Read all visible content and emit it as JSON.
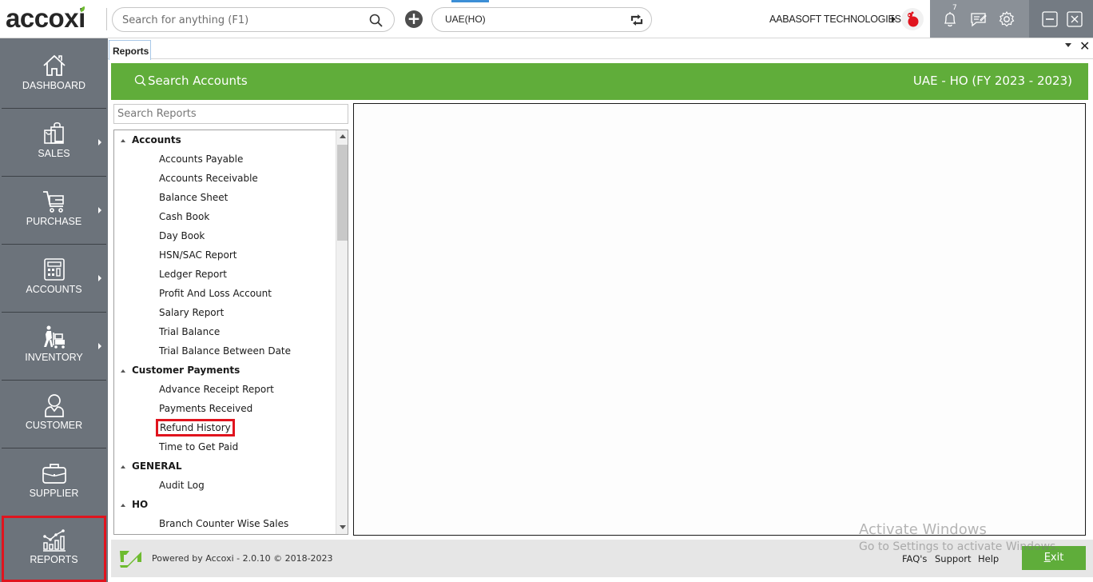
{
  "app": {
    "logo_text": "accoxi",
    "logo_dot_color": "#6dbb2f"
  },
  "topbar": {
    "search_placeholder": "Search for anything (F1)",
    "branch_value": "UAE(HO)",
    "company_name": "AABASOFT TECHNOLOGIES",
    "notification_count": "7",
    "icons": [
      "search-icon",
      "add-icon",
      "sync-icon",
      "bell-icon",
      "message-icon",
      "gear-icon",
      "minimize-icon",
      "close-icon"
    ]
  },
  "sidebar": {
    "items": [
      {
        "label": "DASHBOARD",
        "icon": "home-icon",
        "has_submenu": false
      },
      {
        "label": "SALES",
        "icon": "shopping-bag-icon",
        "has_submenu": true
      },
      {
        "label": "PURCHASE",
        "icon": "cart-icon",
        "has_submenu": true
      },
      {
        "label": "ACCOUNTS",
        "icon": "calculator-icon",
        "has_submenu": true
      },
      {
        "label": "INVENTORY",
        "icon": "trolley-worker-icon",
        "has_submenu": true
      },
      {
        "label": "CUSTOMER",
        "icon": "person-icon",
        "has_submenu": false
      },
      {
        "label": "SUPPLIER",
        "icon": "briefcase-icon",
        "has_submenu": false
      },
      {
        "label": "REPORTS",
        "icon": "chart-icon",
        "has_submenu": false,
        "active": true
      }
    ]
  },
  "tabs": {
    "active_tab": "Reports"
  },
  "header": {
    "search_accounts_label": "Search Accounts",
    "fiscal_label": "UAE - HO (FY 2023 - 2023)",
    "accent_color": "#60ad3a"
  },
  "reports": {
    "search_placeholder": "Search Reports",
    "groups": [
      {
        "name": "Accounts",
        "items": [
          "Accounts Payable",
          "Accounts Receivable",
          "Balance Sheet",
          "Cash Book",
          "Day Book",
          "HSN/SAC Report",
          "Ledger Report",
          "Profit And Loss Account",
          "Salary Report",
          "Trial Balance",
          "Trial Balance Between Date"
        ]
      },
      {
        "name": "Customer Payments",
        "items": [
          "Advance Receipt Report",
          "Payments Received",
          "Refund History",
          "Time to Get Paid"
        ]
      },
      {
        "name": "GENERAL",
        "items": [
          "Audit Log"
        ]
      },
      {
        "name": "HO",
        "items": [
          "Branch Counter Wise Sales"
        ]
      }
    ],
    "highlighted_item": "Refund History"
  },
  "footer": {
    "powered_by": "Powered by Accoxi - 2.0.10 © 2018-2023",
    "links": [
      "FAQ's",
      "Support",
      "Help"
    ],
    "exit_label_prefix": "E",
    "exit_label_rest": "xit"
  },
  "watermark": {
    "line1": "Activate Windows",
    "line2": "Go to Settings to activate Windows."
  }
}
